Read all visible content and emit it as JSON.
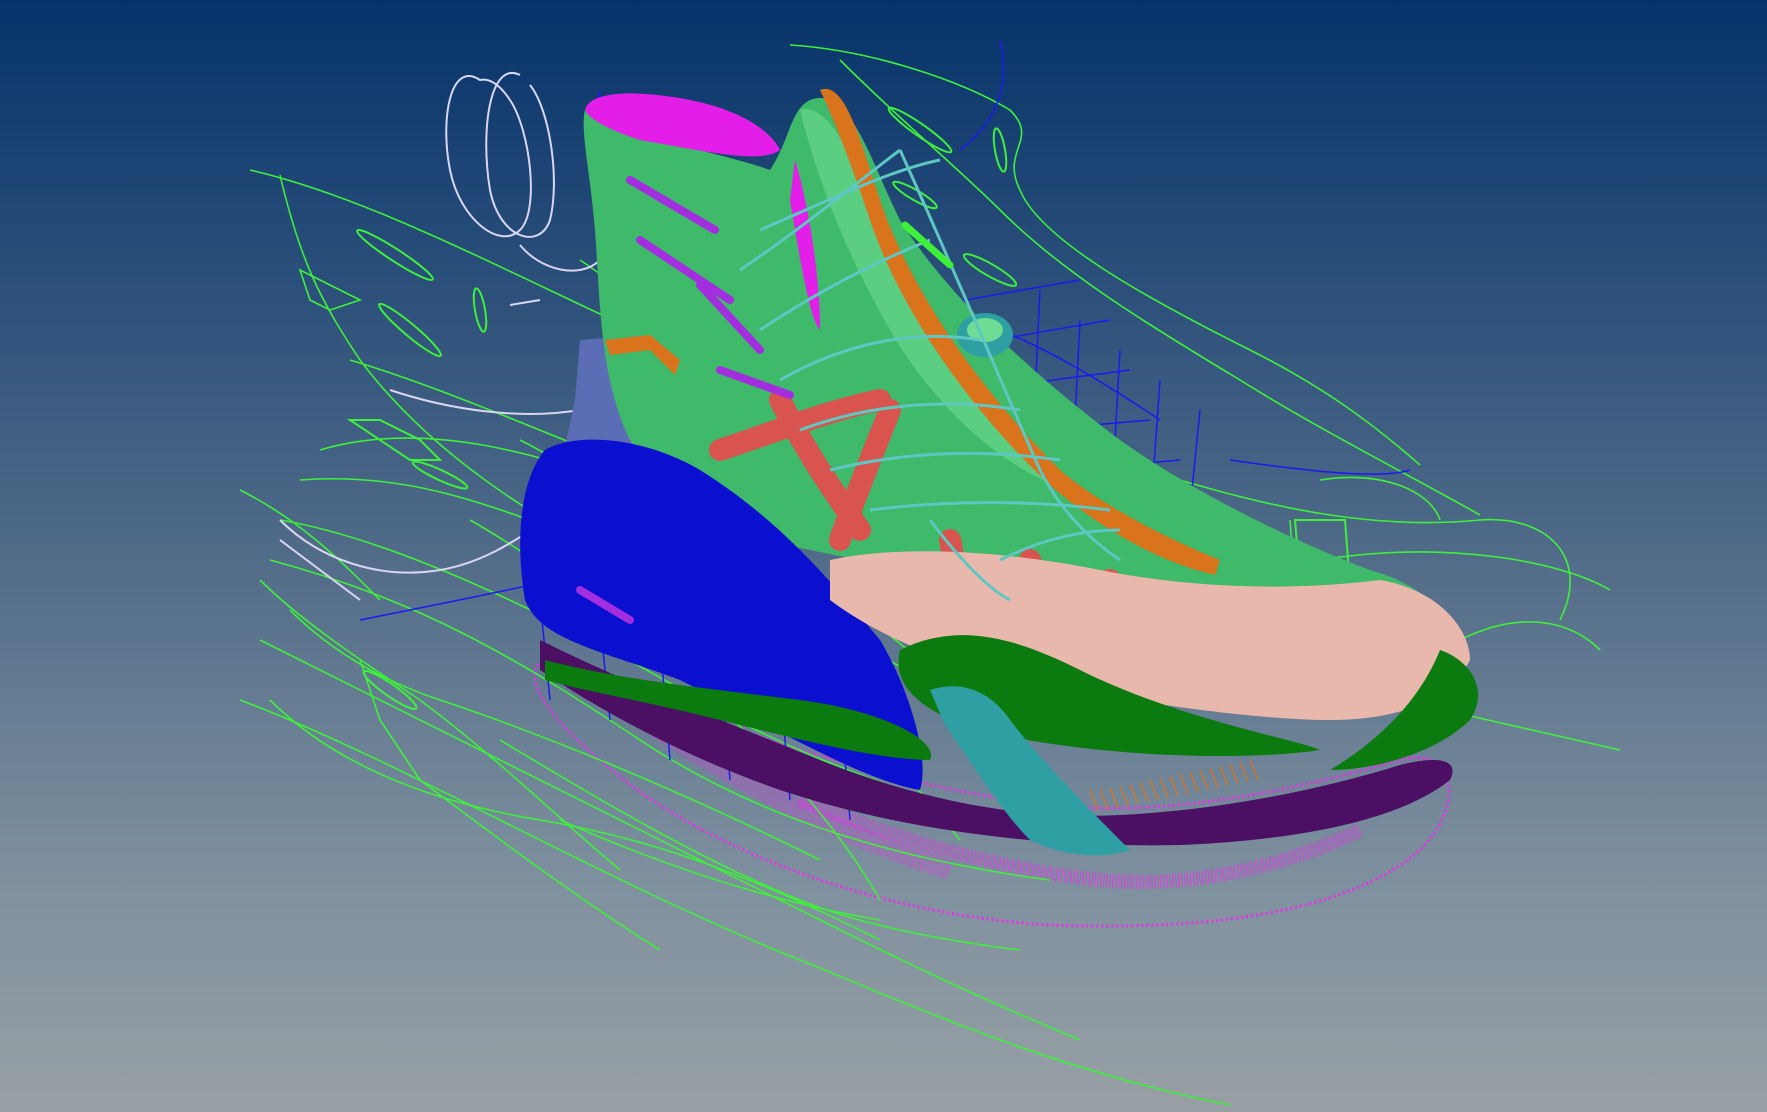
{
  "viewport": {
    "background_top": "#06336a",
    "background_bottom": "#98a0a5"
  },
  "model": {
    "icon": "shoe-model-icon",
    "colors": {
      "collar_lining": "#e21ee8",
      "upper": "#3fb96a",
      "upper_highlight": "#6fdc93",
      "heel_counter": "#0a0fd0",
      "toe_cap": "#e9b8ad",
      "midsole": "#4b0f63",
      "foxing": "#0b7a0f",
      "heel_clip": "#2e9fa3",
      "strap": "#d9544f",
      "lace": "#5fc7c2",
      "eyestay": "#d9731c",
      "heel_panel": "#5a6db5",
      "tpu_accent": "#a22ee0",
      "outsole_pattern": "#ee2cf0",
      "construction_curves": "#3ef03a",
      "construction_curves_alt": "#1a1bf0",
      "reference_curves": "#d8d6f2"
    }
  }
}
